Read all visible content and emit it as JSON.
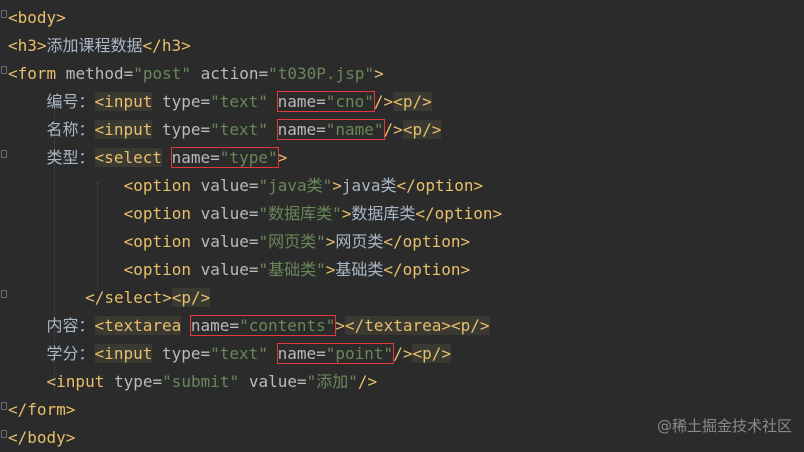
{
  "lines": {
    "l1": {
      "open": "<body>"
    },
    "l2": {
      "open": "<h3>",
      "text": "添加课程数据",
      "close": "</h3>"
    },
    "l3": {
      "open": "<form",
      "attr1": " method=",
      "val1": "\"post\"",
      "attr2": " action=",
      "val2": "\"t030P.jsp\"",
      "end": ">"
    },
    "l4": {
      "label": "编号：",
      "open": "<input",
      "attr1": " type=",
      "val1": "\"text\"",
      "sp": " ",
      "attr2": "name=",
      "val2": "\"cno\"",
      "end": "/>",
      "p": "<p/>"
    },
    "l5": {
      "label": "名称：",
      "open": "<input",
      "attr1": " type=",
      "val1": "\"text\"",
      "sp": " ",
      "attr2": "name=",
      "val2": "\"name\"",
      "end": "/>",
      "p": "<p/>"
    },
    "l6": {
      "label": "类型：",
      "open": "<select",
      "sp": " ",
      "attr1": "name=",
      "val1": "\"type\"",
      "end": ">"
    },
    "l7": {
      "open": "<option",
      "attr": " value=",
      "val": "\"java类\"",
      "gt": ">",
      "text": "java类",
      "close": "</option>"
    },
    "l8": {
      "open": "<option",
      "attr": " value=",
      "val": "\"数据库类\"",
      "gt": ">",
      "text": "数据库类",
      "close": "</option>"
    },
    "l9": {
      "open": "<option",
      "attr": " value=",
      "val": "\"网页类\"",
      "gt": ">",
      "text": "网页类",
      "close": "</option>"
    },
    "l10": {
      "open": "<option",
      "attr": " value=",
      "val": "\"基础类\"",
      "gt": ">",
      "text": "基础类",
      "close": "</option>"
    },
    "l11": {
      "close": "</select>",
      "p": "<p/>"
    },
    "l12": {
      "label": "内容：",
      "open": "<textarea",
      "sp": " ",
      "attr1": "name=",
      "val1": "\"contents\"",
      "end": ">",
      "close": "</textarea>",
      "p": "<p/>"
    },
    "l13": {
      "label": "学分：",
      "open": "<input",
      "attr1": " type=",
      "val1": "\"text\"",
      "sp": " ",
      "attr2": "name=",
      "val2": "\"point\"",
      "end": "/>",
      "p": "<p/>"
    },
    "l14": {
      "open": "<input",
      "attr1": " type=",
      "val1": "\"submit\"",
      "attr2": " value=",
      "val2": "\"添加\"",
      "end": "/>"
    },
    "l15": {
      "close": "</form>"
    },
    "l16": {
      "close": "</body>"
    }
  },
  "watermark": "@稀土掘金技术社区",
  "colors": {
    "background": "#2b2b2b",
    "tag": "#e8bf6a",
    "attribute": "#bababa",
    "string": "#6a8759",
    "text": "#a9b7c6",
    "highlight_box": "#e03b3b"
  }
}
